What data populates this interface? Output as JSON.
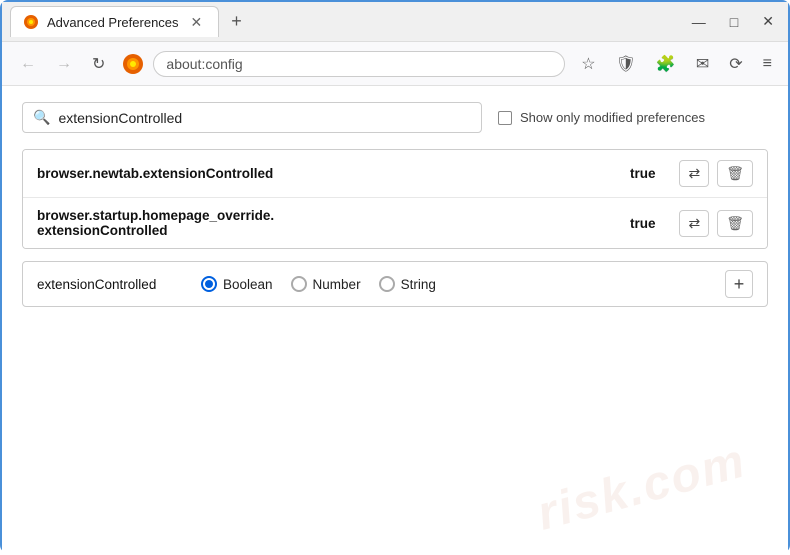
{
  "window": {
    "title": "Advanced Preferences",
    "new_tab_label": "+",
    "close_label": "✕",
    "minimize_label": "—",
    "maximize_label": "□",
    "close_window_label": "✕"
  },
  "nav": {
    "back_label": "←",
    "forward_label": "→",
    "refresh_label": "↻",
    "url": "about:config",
    "browser_name": "Firefox",
    "star_icon": "☆",
    "shield_icon": "🛡",
    "ext_icon": "🧩",
    "mail_icon": "✉",
    "sync_icon": "⟳",
    "menu_icon": "≡"
  },
  "search": {
    "placeholder": "extensionControlled",
    "value": "extensionControlled",
    "show_modified_label": "Show only modified preferences"
  },
  "preferences": [
    {
      "name": "browser.newtab.extensionControlled",
      "value": "true",
      "toggle_label": "⇄",
      "delete_label": "🗑"
    },
    {
      "name": "browser.startup.homepage_override.\nextensionControlled",
      "name_line1": "browser.startup.homepage_override.",
      "name_line2": "extensionControlled",
      "value": "true",
      "toggle_label": "⇄",
      "delete_label": "🗑"
    }
  ],
  "new_pref": {
    "name": "extensionControlled",
    "types": [
      {
        "label": "Boolean",
        "selected": true
      },
      {
        "label": "Number",
        "selected": false
      },
      {
        "label": "String",
        "selected": false
      }
    ],
    "add_label": "+"
  },
  "watermark": {
    "text": "risk.com"
  }
}
